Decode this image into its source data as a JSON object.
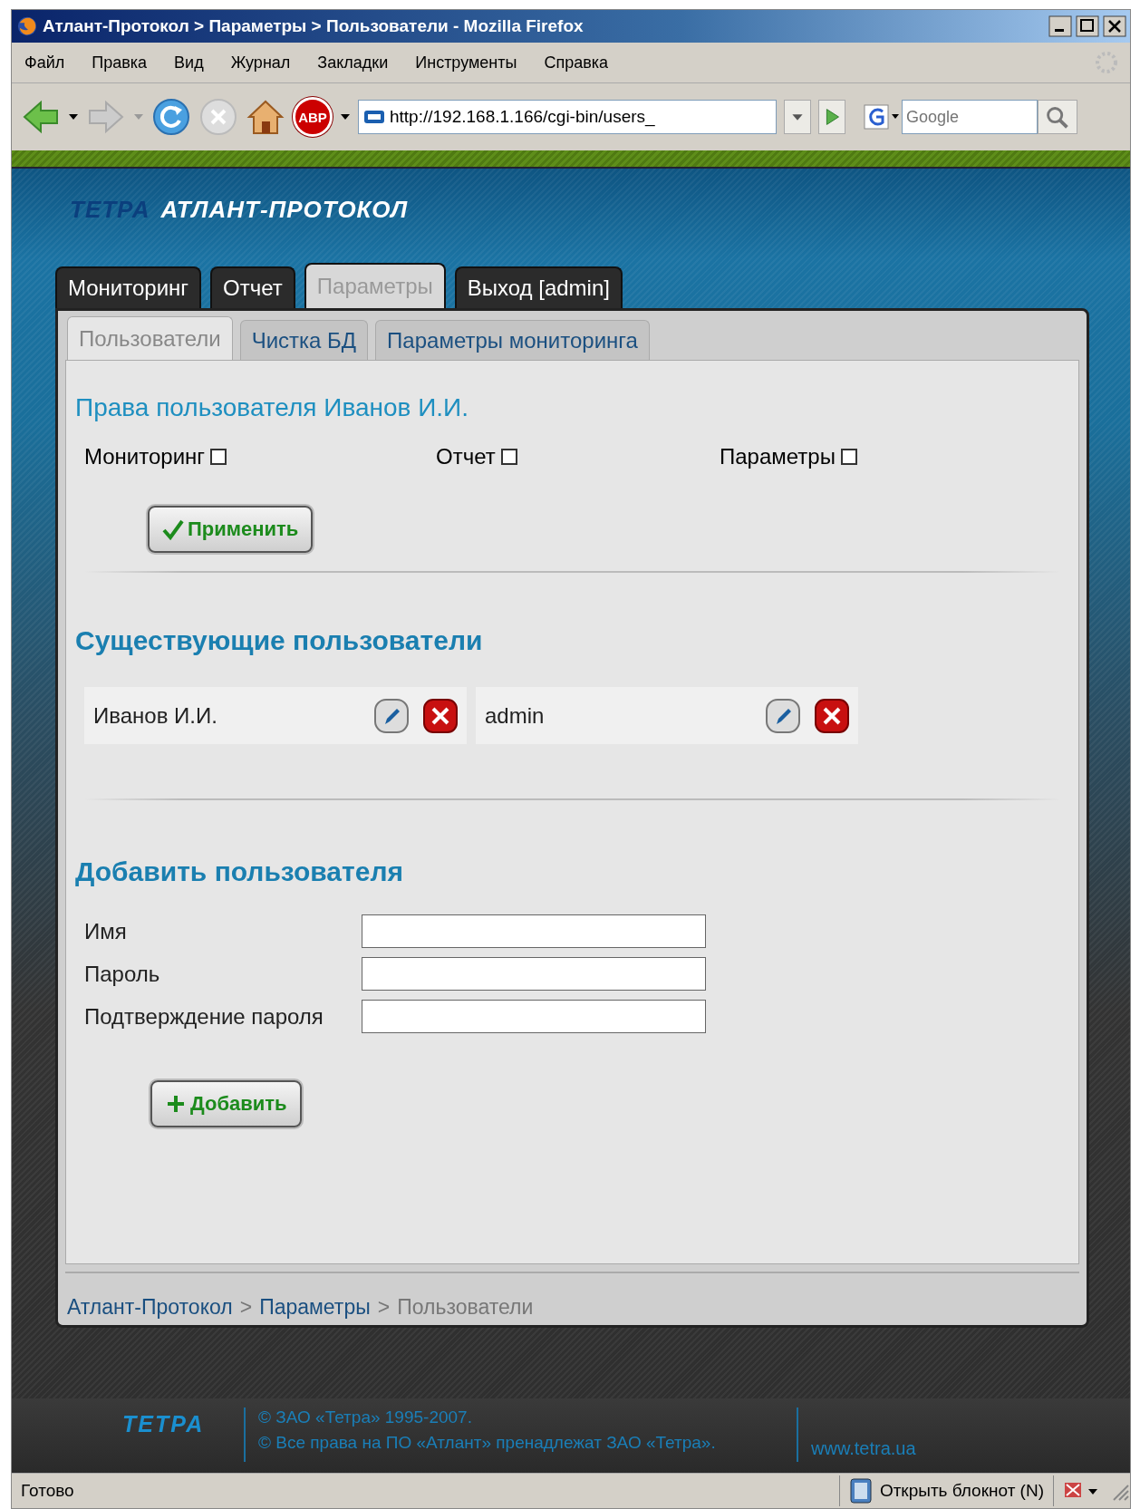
{
  "window": {
    "title": "Атлант-Протокол > Параметры > Пользователи - Mozilla Firefox"
  },
  "menu": [
    {
      "label": "Файл"
    },
    {
      "label": "Правка"
    },
    {
      "label": "Вид"
    },
    {
      "label": "Журнал"
    },
    {
      "label": "Закладки"
    },
    {
      "label": "Инструменты"
    },
    {
      "label": "Справка"
    }
  ],
  "toolbar": {
    "adblock_label": "ABP",
    "url": "http://192.168.1.166/cgi-bin/users_",
    "search_placeholder": "Google"
  },
  "header": {
    "brand": "ТЕТРА",
    "product": "АТЛАНТ-ПРОТОКОЛ"
  },
  "main_tabs": [
    {
      "label": "Мониторинг",
      "selected": false
    },
    {
      "label": "Отчет",
      "selected": false
    },
    {
      "label": "Параметры",
      "selected": true
    },
    {
      "label": "Выход [admin]",
      "selected": false
    }
  ],
  "sub_tabs": [
    {
      "label": "Пользователи",
      "selected": true
    },
    {
      "label": "Чистка БД",
      "selected": false
    },
    {
      "label": "Параметры мониторинга",
      "selected": false
    }
  ],
  "permissions": {
    "title": "Права пользователя Иванов И.И.",
    "checkboxes": [
      {
        "label": "Мониторинг",
        "checked": false
      },
      {
        "label": "Отчет",
        "checked": false
      },
      {
        "label": "Параметры",
        "checked": false
      }
    ],
    "button": "Применить"
  },
  "users": {
    "title": "Существующие пользователи",
    "items": [
      {
        "name": "Иванов И.И."
      },
      {
        "name": "admin"
      }
    ]
  },
  "add_user": {
    "title": "Добавить пользователя",
    "fields": [
      {
        "label": "Имя"
      },
      {
        "label": "Пароль"
      },
      {
        "label": "Подтверждение пароля"
      }
    ],
    "button": "Добавить"
  },
  "breadcrumb": [
    {
      "text": "Атлант-Протокол",
      "kind": "link"
    },
    {
      "text": ">",
      "kind": "sep"
    },
    {
      "text": "Параметры",
      "kind": "link"
    },
    {
      "text": ">",
      "kind": "sep"
    },
    {
      "text": "Пользователи",
      "kind": "current"
    }
  ],
  "footer": {
    "brand": "ТЕТРА",
    "lines": [
      "© ЗАО «Тетра» 1995-2007.",
      "© Все права на ПО «Атлант» пренадлежат ЗАО «Тетра»."
    ],
    "site": "www.tetra.ua"
  },
  "status_bar": {
    "status": "Готово",
    "notepad": "Открыть блокнот (N)"
  }
}
